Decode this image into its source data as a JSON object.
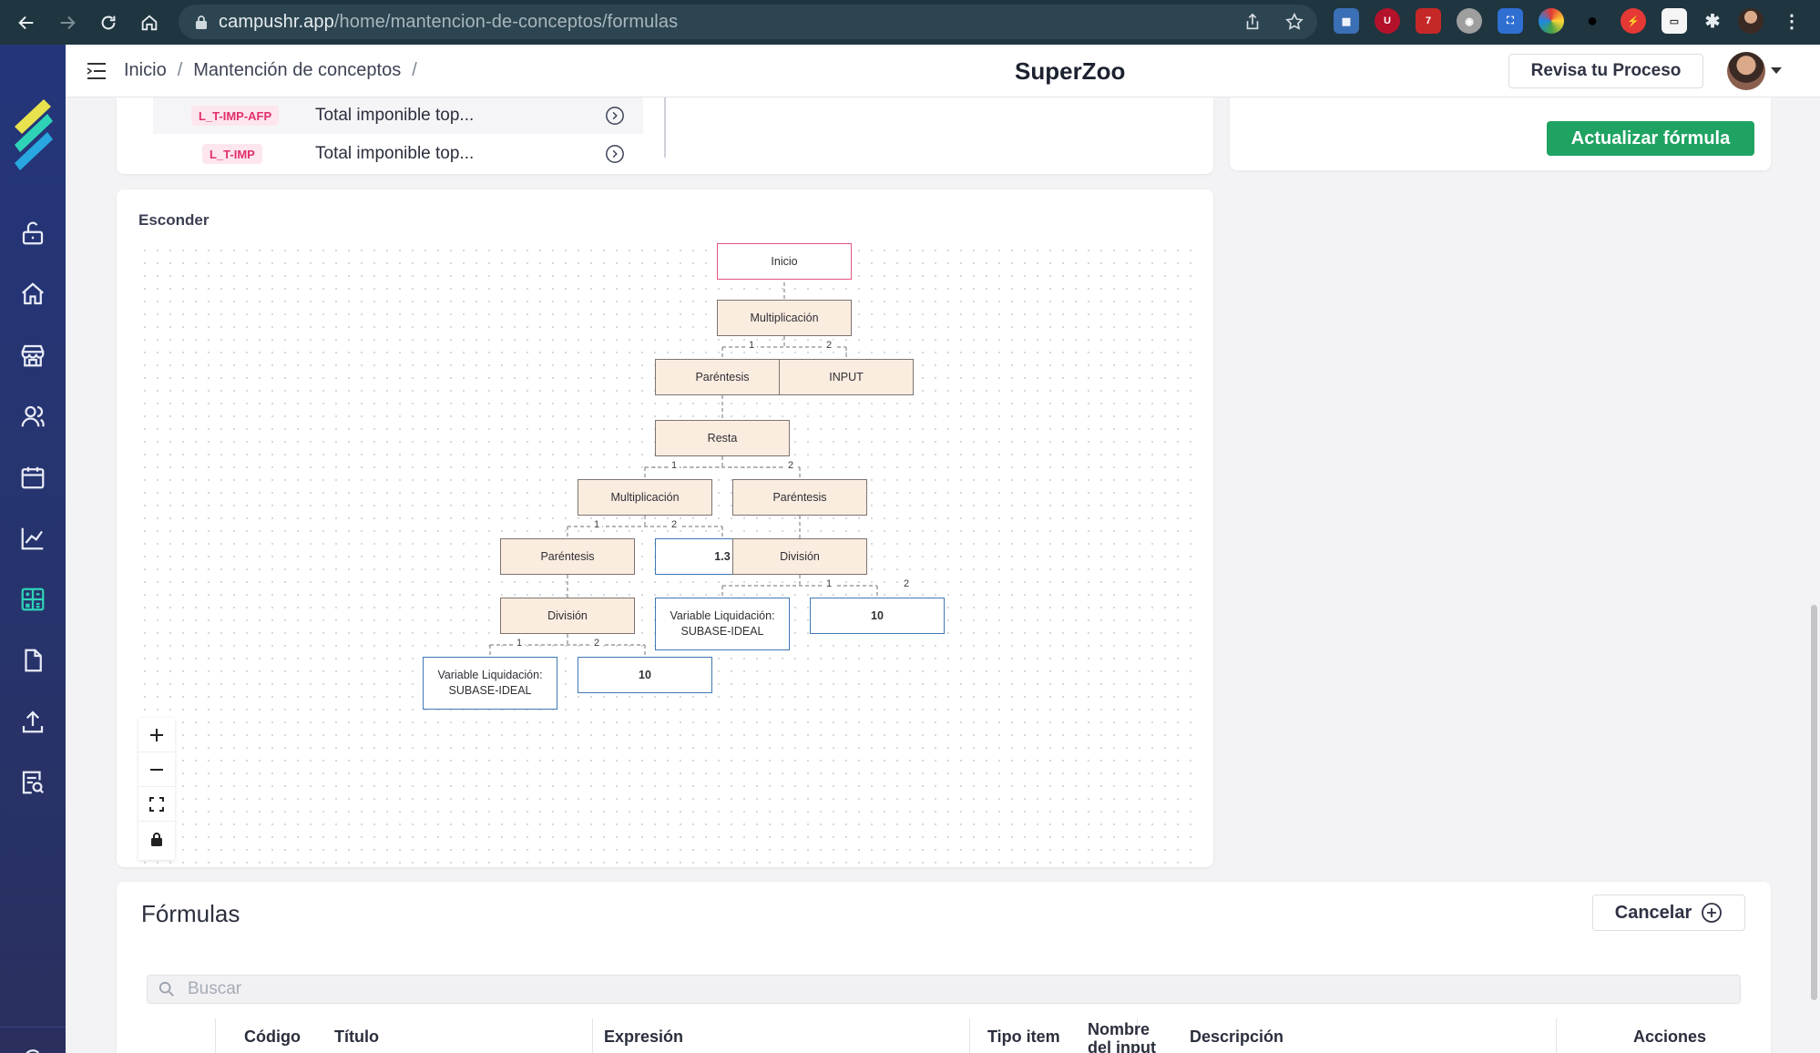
{
  "browser": {
    "url_host": "campushr.app",
    "url_path": "/home/mantencion-de-conceptos/formulas",
    "extension_badge": "7"
  },
  "header": {
    "breadcrumb": [
      "Inicio",
      "Mantención de conceptos"
    ],
    "breadcrumb_separator": "/",
    "app_title": "SuperZoo",
    "process_button": "Revisa tu Proceso"
  },
  "concepts_fragment": {
    "rows": [
      {
        "code": "L_T-IMP-AFP",
        "title": "Total imponible top..."
      },
      {
        "code": "L_T-IMP",
        "title": "Total imponible top..."
      }
    ]
  },
  "formula_panel": {
    "update_button": "Actualizar fórmula"
  },
  "tree": {
    "hide_label": "Esconder",
    "nodes": {
      "inicio": "Inicio",
      "mult1": "Multiplicación",
      "par1": "Paréntesis",
      "input1": "INPUT",
      "resta": "Resta",
      "mult2": "Multiplicación",
      "par2": "Paréntesis",
      "par3": "Paréntesis",
      "num13": "1.3",
      "div1": "División",
      "div2": "División",
      "var1_line1": "Variable Liquidación:",
      "var1_line2": "SUBASE-IDEAL",
      "num10a": "10",
      "var2_line1": "Variable Liquidación:",
      "var2_line2": "SUBASE-IDEAL",
      "num10b": "10"
    },
    "edge_labels": {
      "first": "1",
      "second": "2"
    },
    "controls": [
      "zoom-in",
      "zoom-out",
      "fit-view",
      "lock"
    ]
  },
  "formulas": {
    "title": "Fórmulas",
    "cancel_button": "Cancelar",
    "search_placeholder": "Buscar",
    "columns": [
      "Código",
      "Título",
      "Expresión",
      "Tipo item",
      "Nombre del input",
      "Descripción",
      "Acciones"
    ]
  },
  "colors": {
    "chrome": "#1f3540",
    "rail": "#24357a",
    "accent_green": "#1fa363",
    "tag_pink": "#e1306c",
    "node_fill": "#fbece0",
    "leaf_border": "#3f78b4"
  }
}
